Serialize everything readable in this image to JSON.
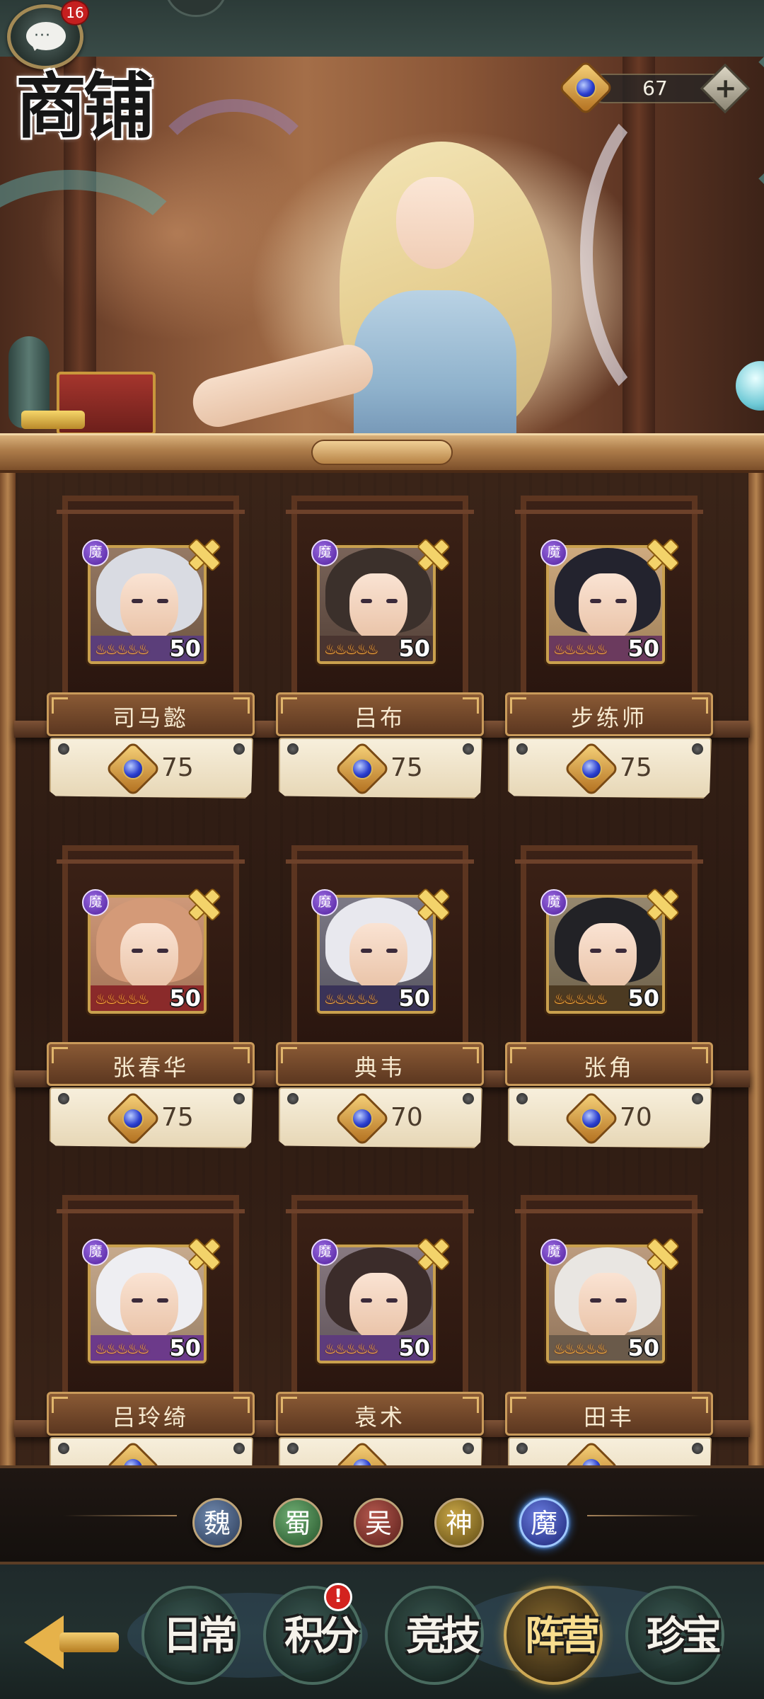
{
  "header": {
    "title": "商铺",
    "chat_badge_count": "16",
    "currency": {
      "icon": "blue-gem-icon",
      "amount": "67",
      "add_label": "+"
    }
  },
  "shop": {
    "faction_tag": "魔",
    "items": [
      {
        "name": "司马懿",
        "level": "50",
        "price": "75",
        "stars": 5,
        "colors": {
          "bg": "#8a6a52",
          "hair": "#d9dbe2",
          "cloth": "#5b3e7a"
        }
      },
      {
        "name": "吕布",
        "level": "50",
        "price": "75",
        "stars": 5,
        "colors": {
          "bg": "#6a5246",
          "hair": "#3b302b",
          "cloth": "#4a3530"
        }
      },
      {
        "name": "步练师",
        "level": "50",
        "price": "75",
        "stars": 5,
        "colors": {
          "bg": "#c8a070",
          "hair": "#23232e",
          "cloth": "#6b3a5e"
        }
      },
      {
        "name": "张春华",
        "level": "50",
        "price": "75",
        "stars": 5,
        "colors": {
          "bg": "#c98d6a",
          "hair": "#d49a78",
          "cloth": "#8a2a2a"
        }
      },
      {
        "name": "典韦",
        "level": "50",
        "price": "70",
        "stars": 5,
        "colors": {
          "bg": "#6d6a78",
          "hair": "#e8e8ee",
          "cloth": "#3a3358"
        }
      },
      {
        "name": "张角",
        "level": "50",
        "price": "70",
        "stars": 5,
        "colors": {
          "bg": "#8a7a5e",
          "hair": "#222226",
          "cloth": "#4c3a22"
        }
      },
      {
        "name": "吕玲绮",
        "level": "50",
        "price": "",
        "stars": 5,
        "colors": {
          "bg": "#c0a080",
          "hair": "#eeeef2",
          "cloth": "#6c3a8a"
        }
      },
      {
        "name": "袁术",
        "level": "50",
        "price": "",
        "stars": 5,
        "colors": {
          "bg": "#7a6a72",
          "hair": "#3b2c2a",
          "cloth": "#5e3c7c"
        }
      },
      {
        "name": "田丰",
        "level": "50",
        "price": "",
        "stars": 5,
        "colors": {
          "bg": "#b49070",
          "hair": "#e9e6e2",
          "cloth": "#6a5a4a"
        }
      }
    ]
  },
  "filters": [
    {
      "label": "魏",
      "key": "wei",
      "selected": false
    },
    {
      "label": "蜀",
      "key": "shu",
      "selected": false
    },
    {
      "label": "吴",
      "key": "wu",
      "selected": false
    },
    {
      "label": "神",
      "key": "shen",
      "selected": false
    },
    {
      "label": "魔",
      "key": "mo",
      "selected": true
    }
  ],
  "nav": {
    "tabs": [
      {
        "label": "日常",
        "active": false,
        "alert": false
      },
      {
        "label": "积分",
        "active": false,
        "alert": true,
        "alert_text": "!"
      },
      {
        "label": "竞技",
        "active": false,
        "alert": false
      },
      {
        "label": "阵营",
        "active": true,
        "alert": false
      },
      {
        "label": "珍宝",
        "active": false,
        "alert": false
      }
    ]
  }
}
